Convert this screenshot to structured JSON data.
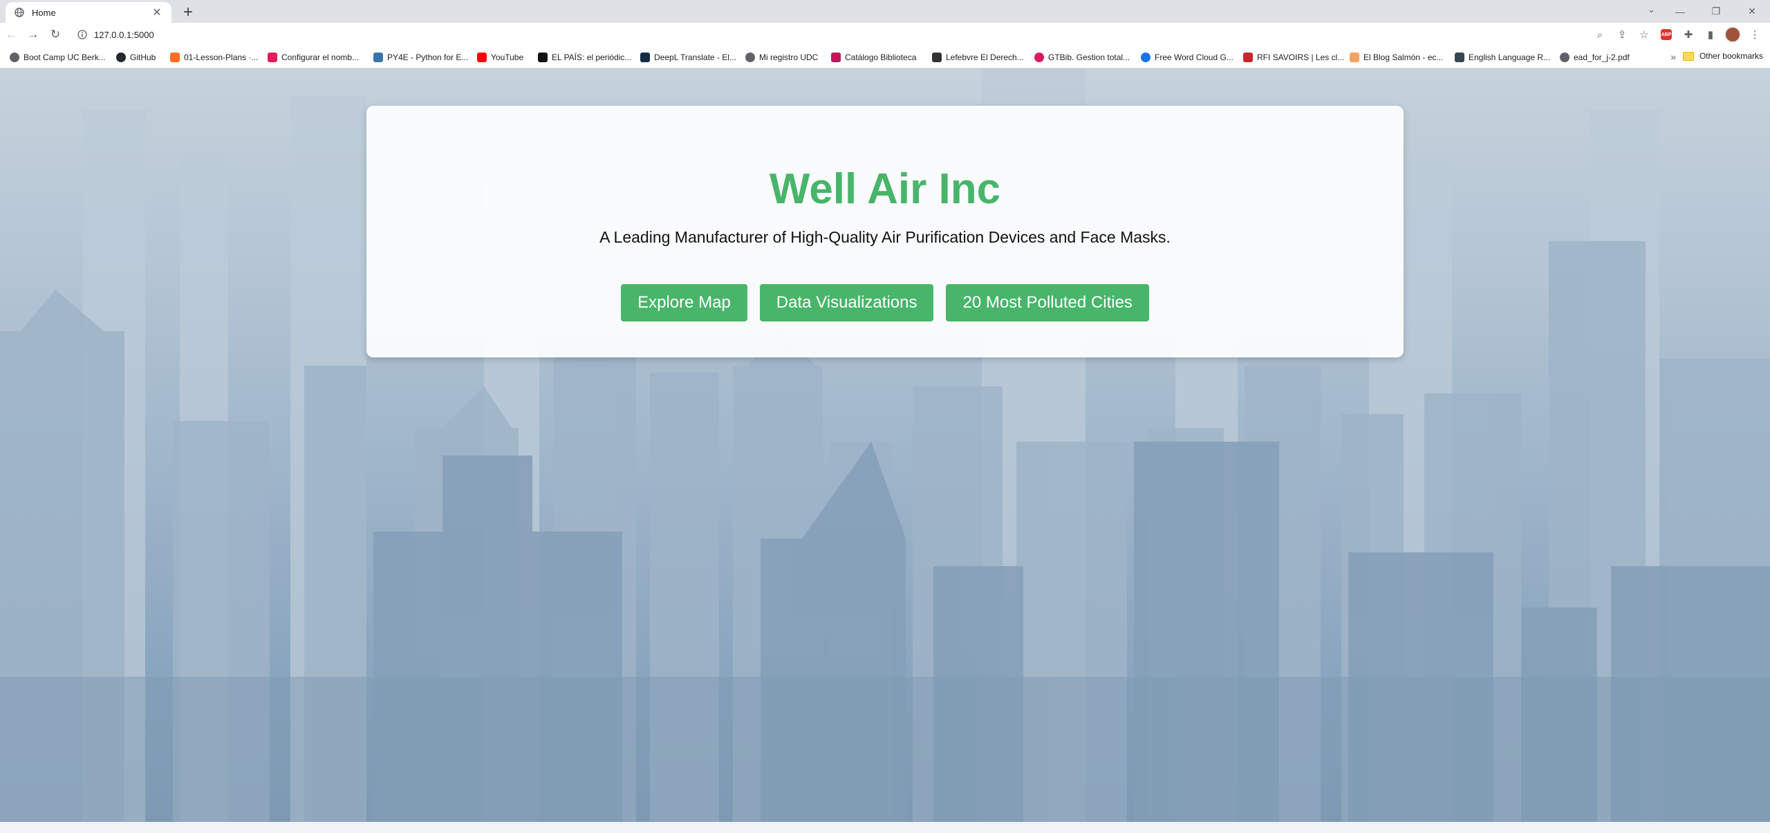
{
  "browser": {
    "tab": {
      "title": "Home"
    },
    "url": "127.0.0.1:5000",
    "bookmarks": [
      "Boot Camp UC Berk...",
      "GitHub",
      "01-Lesson-Plans ·...",
      "Configurar el nomb...",
      "PY4E - Python for E...",
      "YouTube",
      "EL PAÍS: el periódic...",
      "DeepL Translate - El...",
      "Mi registro UDC",
      "Catálogo Biblioteca",
      "Lefebvre El Derech...",
      "GTBib. Gestion total...",
      "Free Word Cloud G...",
      "RFI SAVOIRS | Les cl...",
      "El Blog Salmón - ec...",
      "English Language R...",
      "ead_for_j-2.pdf"
    ],
    "other_bookmarks": "Other bookmarks"
  },
  "hero": {
    "title": "Well Air Inc",
    "subtitle": "A Leading Manufacturer of High-Quality Air Purification Devices and Face Masks.",
    "buttons": [
      "Explore Map",
      "Data Visualizations",
      "20 Most Polluted Cities"
    ]
  },
  "colors": {
    "accent": "#48b56a",
    "tab_strip": "#dee1e6"
  }
}
